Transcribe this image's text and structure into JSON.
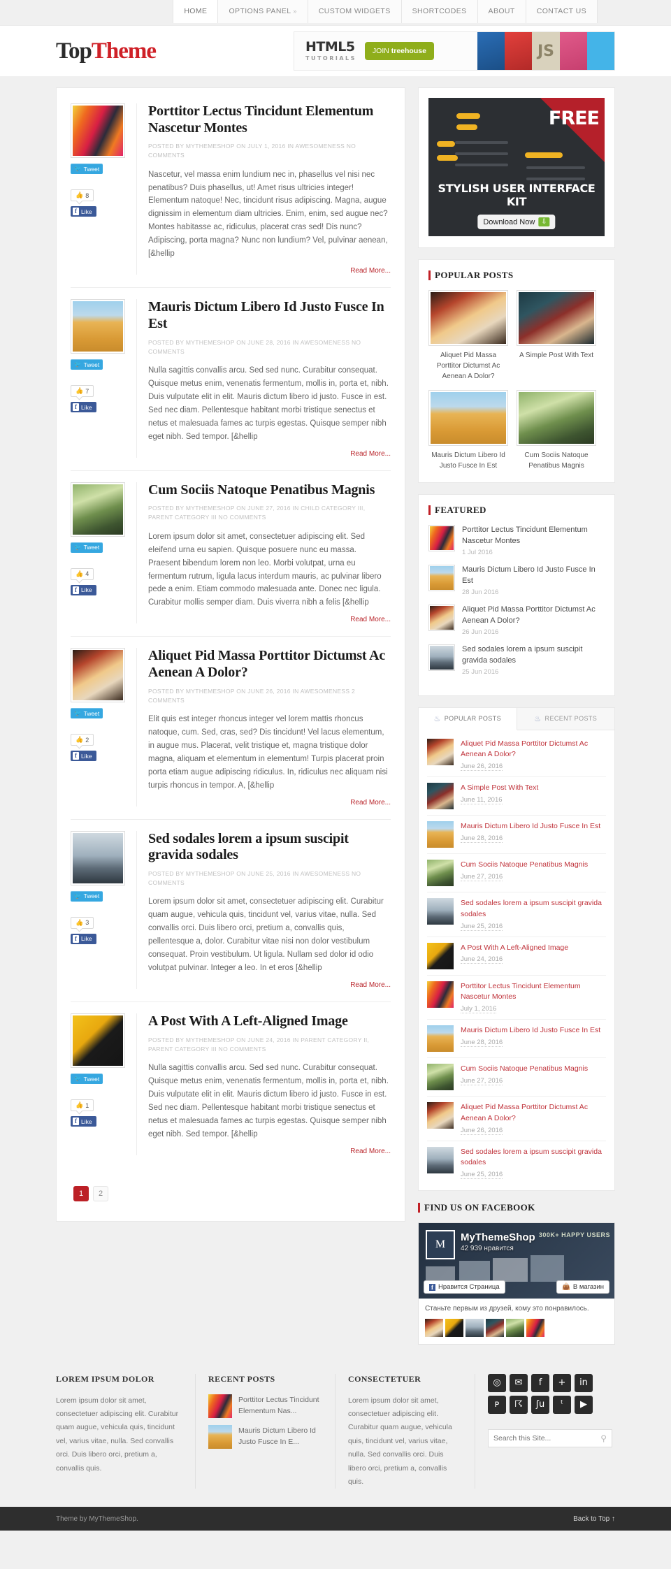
{
  "nav": {
    "items": [
      {
        "label": "HOME",
        "active": true,
        "caret": ""
      },
      {
        "label": "OPTIONS PANEL",
        "active": false,
        "caret": "»"
      },
      {
        "label": "CUSTOM WIDGETS",
        "active": false,
        "caret": ""
      },
      {
        "label": "SHORTCODES",
        "active": false,
        "caret": ""
      },
      {
        "label": "ABOUT",
        "active": false,
        "caret": ""
      },
      {
        "label": "CONTACT US",
        "active": false,
        "caret": ""
      }
    ]
  },
  "header": {
    "logo_part1": "Top",
    "logo_part2": "Theme",
    "banner": {
      "title": "HTML5",
      "subtitle": "TUTORIALS",
      "cta_prefix": "JOIN ",
      "cta_brand": "treehouse"
    }
  },
  "posts": [
    {
      "title": "Porttitor Lectus Tincidunt Elementum Nascetur Montes",
      "meta": "POSTED BY MYTHEMESHOP ON JULY 1, 2016 IN AWESOMENESS NO COMMENTS",
      "excerpt": "Nascetur, vel massa enim lundium nec in, phasellus vel nisi nec penatibus? Duis phasellus, ut! Amet risus ultricies integer! Elementum natoque! Nec, tincidunt risus adipiscing. Magna, augue dignissim in elementum diam ultricies. Enim, enim, sed augue nec? Montes habitasse ac, ridiculus, placerat cras sed! Dis nunc? Adipiscing, porta magna? Nunc non lundium? Vel, pulvinar aenean, [&hellip",
      "tweet_label": "Tweet",
      "like_count": "8",
      "like_label": "Like",
      "read_more": "Read More...",
      "image": "img-cables"
    },
    {
      "title": "Mauris Dictum Libero Id Justo Fusce In Est",
      "meta": "POSTED BY MYTHEMESHOP ON JUNE 28, 2016 IN AWESOMENESS NO COMMENTS",
      "excerpt": "Nulla sagittis convallis arcu. Sed sed nunc. Curabitur consequat. Quisque metus enim, venenatis fermentum, mollis in, porta et, nibh. Duis vulputate elit in elit. Mauris dictum libero id justo. Fusce in est. Sed nec diam. Pellentesque habitant morbi tristique senectus et netus et malesuada fames ac turpis egestas. Quisque semper nibh eget nibh. Sed tempor. [&hellip",
      "tweet_label": "Tweet",
      "like_count": "7",
      "like_label": "Like",
      "read_more": "Read More...",
      "image": "img-sand"
    },
    {
      "title": "Cum Sociis Natoque Penatibus Magnis",
      "meta": "POSTED BY MYTHEMESHOP ON JUNE 27, 2016 IN CHILD CATEGORY III, PARENT CATEGORY III NO COMMENTS",
      "excerpt": "Lorem ipsum dolor sit amet, consectetuer adipiscing elit. Sed eleifend urna eu sapien. Quisque posuere nunc eu massa. Praesent bibendum lorem non leo. Morbi volutpat, urna eu fermentum rutrum, ligula lacus interdum mauris, ac pulvinar libero pede a enim. Etiam commodo malesuada ante. Donec nec ligula. Curabitur mollis semper diam. Duis viverra nibh a felis [&hellip",
      "tweet_label": "Tweet",
      "like_count": "4",
      "like_label": "Like",
      "read_more": "Read More...",
      "image": "img-bird"
    },
    {
      "title": "Aliquet Pid Massa Porttitor Dictumst Ac Aenean A Dolor?",
      "meta": "POSTED BY MYTHEMESHOP ON JUNE 26, 2016 IN AWESOMENESS 2 COMMENTS",
      "excerpt": "Elit quis est integer rhoncus integer vel lorem mattis rhoncus natoque, cum. Sed, cras, sed? Dis tincidunt! Vel lacus elementum, in augue mus. Placerat, velit tristique et, magna tristique dolor magna, aliquam et elementum in elementum! Turpis placerat proin porta etiam augue adipiscing ridiculus. In, ridiculus nec aliquam nisi turpis rhoncus in tempor. A, [&hellip",
      "tweet_label": "Tweet",
      "like_count": "2",
      "like_label": "Like",
      "read_more": "Read More...",
      "image": "img-crowd"
    },
    {
      "title": "Sed sodales lorem a ipsum suscipit gravida sodales",
      "meta": "POSTED BY MYTHEMESHOP ON JUNE 25, 2016 IN AWESOMENESS NO COMMENTS",
      "excerpt": "Lorem ipsum dolor sit amet, consectetuer adipiscing elit. Curabitur quam augue, vehicula quis, tincidunt vel, varius vitae, nulla. Sed convallis orci. Duis libero orci, pretium a, convallis quis, pellentesque a, dolor. Curabitur vitae nisi non dolor vestibulum consequat. Proin vestibulum. Ut ligula. Nullam sed dolor id odio volutpat pulvinar. Integer a leo. In et eros [&hellip",
      "tweet_label": "Tweet",
      "like_count": "3",
      "like_label": "Like",
      "read_more": "Read More...",
      "image": "img-sky"
    },
    {
      "title": "A Post With A Left-Aligned Image",
      "meta": "POSTED BY MYTHEMESHOP ON JUNE 24, 2016 IN PARENT CATEGORY II, PARENT CATEGORY III NO COMMENTS",
      "excerpt": "Nulla sagittis convallis arcu. Sed sed nunc. Curabitur consequat. Quisque metus enim, venenatis fermentum, mollis in, porta et, nibh. Duis vulputate elit in elit. Mauris dictum libero id justo. Fusce in est. Sed nec diam. Pellentesque habitant morbi tristique senectus et netus et malesuada fames ac turpis egestas. Quisque semper nibh eget nibh. Sed tempor. [&hellip",
      "tweet_label": "Tweet",
      "like_count": "1",
      "like_label": "Like",
      "read_more": "Read More...",
      "image": "img-silh"
    }
  ],
  "pagination": {
    "pages": [
      "1",
      "2"
    ],
    "current": "1"
  },
  "sidebar": {
    "ad": {
      "free_label": "FREE",
      "kit_label": "STYLISH USER INTERFACE KIT",
      "download_label": "Download Now",
      "arrow": "»"
    },
    "popular_posts": {
      "title": "POPULAR POSTS",
      "items": [
        {
          "caption": "Aliquet Pid Massa Porttitor Dictumst Ac Aenean A Dolor?",
          "image": "img-crowd"
        },
        {
          "caption": "A Simple Post With Text",
          "image": "img-cello"
        },
        {
          "caption": "Mauris Dictum Libero Id Justo Fusce In Est",
          "image": "img-sand"
        },
        {
          "caption": "Cum Sociis Natoque Penatibus Magnis",
          "image": "img-bird"
        }
      ]
    },
    "featured": {
      "title": "FEATURED",
      "items": [
        {
          "title": "Porttitor Lectus Tincidunt Elementum Nascetur Montes",
          "date": "1 Jul 2016",
          "image": "img-cables"
        },
        {
          "title": "Mauris Dictum Libero Id Justo Fusce In Est",
          "date": "28 Jun 2016",
          "image": "img-sand"
        },
        {
          "title": "Aliquet Pid Massa Porttitor Dictumst Ac Aenean A Dolor?",
          "date": "26 Jun 2016",
          "image": "img-crowd"
        },
        {
          "title": "Sed sodales lorem a ipsum suscipit gravida sodales",
          "date": "25 Jun 2016",
          "image": "img-sky"
        }
      ]
    },
    "tabs": {
      "tab1": "POPULAR POSTS",
      "tab2": "RECENT POSTS",
      "items": [
        {
          "title": "Aliquet Pid Massa Porttitor Dictumst Ac Aenean A Dolor?",
          "date": "June 26, 2016",
          "image": "img-crowd"
        },
        {
          "title": "A Simple Post With Text",
          "date": "June 11, 2016",
          "image": "img-cello"
        },
        {
          "title": "Mauris Dictum Libero Id Justo Fusce In Est",
          "date": "June 28, 2016",
          "image": "img-sand"
        },
        {
          "title": "Cum Sociis Natoque Penatibus Magnis",
          "date": "June 27, 2016",
          "image": "img-bird"
        },
        {
          "title": "Sed sodales lorem a ipsum suscipit gravida sodales",
          "date": "June 25, 2016",
          "image": "img-sky"
        },
        {
          "title": "A Post With A Left-Aligned Image",
          "date": "June 24, 2016",
          "image": "img-silh"
        },
        {
          "title": "Porttitor Lectus Tincidunt Elementum Nascetur Montes",
          "date": "July 1, 2016",
          "image": "img-cables"
        },
        {
          "title": "Mauris Dictum Libero Id Justo Fusce In Est",
          "date": "June 28, 2016",
          "image": "img-sand"
        },
        {
          "title": "Cum Sociis Natoque Penatibus Magnis",
          "date": "June 27, 2016",
          "image": "img-bird"
        },
        {
          "title": "Aliquet Pid Massa Porttitor Dictumst Ac Aenean A Dolor?",
          "date": "June 26, 2016",
          "image": "img-crowd"
        },
        {
          "title": "Sed sodales lorem a ipsum suscipit gravida sodales",
          "date": "June 25, 2016",
          "image": "img-sky"
        }
      ]
    },
    "facebook": {
      "title": "FIND US ON FACEBOOK",
      "page_name": "MyThemeShop",
      "likes": "42 939 нравится",
      "badge": "300K+ HAPPY USERS",
      "like_button": "Нравится Страница",
      "shop_button": "В магазин",
      "footer_text": "Станьте первым из друзей, кому это понравилось.",
      "avatar_letter": "M"
    }
  },
  "footer": {
    "col1": {
      "title": "LOREM IPSUM DOLOR",
      "text": "Lorem ipsum dolor sit amet, consectetuer adipiscing elit. Curabitur quam augue, vehicula quis, tincidunt vel, varius vitae, nulla. Sed convallis orci. Duis libero orci, pretium a, convallis quis."
    },
    "col2": {
      "title": "RECENT POSTS",
      "items": [
        {
          "title": "Porttitor Lectus Tincidunt Elementum Nas...",
          "image": "img-cables"
        },
        {
          "title": "Mauris Dictum Libero Id Justo Fusce In E...",
          "image": "img-sand"
        }
      ]
    },
    "col3": {
      "title": "CONSECTETUER",
      "text": "Lorem ipsum dolor sit amet, consectetuer adipiscing elit. Curabitur quam augue, vehicula quis, tincidunt vel, varius vitae, nulla. Sed convallis orci. Duis libero orci, pretium a, convallis quis."
    },
    "social": [
      {
        "name": "dribbble-icon",
        "glyph": "◎"
      },
      {
        "name": "email-icon",
        "glyph": "✉"
      },
      {
        "name": "facebook-icon",
        "glyph": "f"
      },
      {
        "name": "google-plus-icon",
        "glyph": "+"
      },
      {
        "name": "linkedin-icon",
        "glyph": "in"
      },
      {
        "name": "pinterest-icon",
        "glyph": "ᴘ"
      },
      {
        "name": "rss-icon",
        "glyph": "☈"
      },
      {
        "name": "stumbleupon-icon",
        "glyph": "ʃu"
      },
      {
        "name": "twitter-icon",
        "glyph": "ᵗ"
      },
      {
        "name": "youtube-icon",
        "glyph": "▶"
      }
    ],
    "search_placeholder": "Search this Site...",
    "copyright": "Theme by MyThemeShop.",
    "back_to_top": "Back to Top ↑"
  },
  "colors": {
    "accent": "#c12026",
    "link": "#b9262c",
    "dark": "#2e2e2e"
  }
}
